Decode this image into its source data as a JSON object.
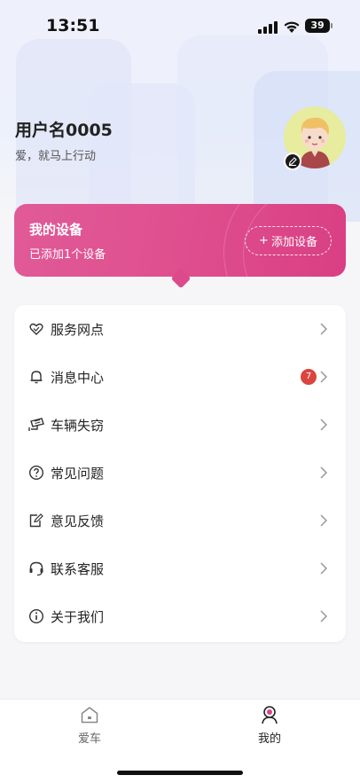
{
  "status_bar": {
    "time": "13:51",
    "battery": "39"
  },
  "profile": {
    "username": "用户名0005",
    "slogan": "爱，就马上行动",
    "avatar_icon": "avatar-cartoon-boy",
    "edit_icon": "edit-pencil-icon"
  },
  "device_card": {
    "title": "我的设备",
    "subtitle": "已添加1个设备",
    "add_button": "添加设备",
    "add_icon": "+",
    "gradient": [
      "#e15a98",
      "#d93f84"
    ]
  },
  "menu": {
    "items": [
      {
        "label": "服务网点",
        "icon": "service-point-icon"
      },
      {
        "label": "消息中心",
        "icon": "bell-icon",
        "badge": "7"
      },
      {
        "label": "车辆失窃",
        "icon": "camera-icon"
      },
      {
        "label": "常见问题",
        "icon": "question-icon"
      },
      {
        "label": "意见反馈",
        "icon": "feedback-icon"
      },
      {
        "label": "联系客服",
        "icon": "headset-icon"
      },
      {
        "label": "关于我们",
        "icon": "info-icon"
      }
    ]
  },
  "tabbar": {
    "tabs": [
      {
        "label": "爱车",
        "icon": "home-icon",
        "active": false
      },
      {
        "label": "我的",
        "icon": "user-icon",
        "active": true
      }
    ]
  },
  "colors": {
    "accent": "#d94488",
    "badge": "#d9463f"
  }
}
